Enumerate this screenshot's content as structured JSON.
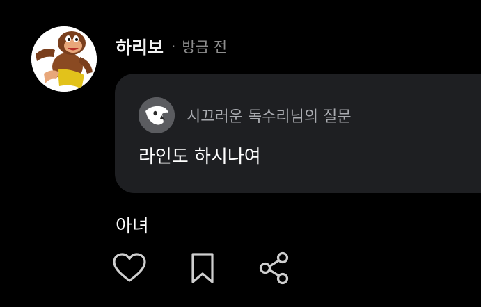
{
  "post": {
    "username": "하리보",
    "separator": "·",
    "timestamp": "방금 전"
  },
  "question": {
    "asker": "시끄러운 독수리님의 질문",
    "text": "라인도 하시나여"
  },
  "answer": {
    "text": "아녀"
  },
  "actions": [
    {
      "icon": "heart-icon"
    },
    {
      "icon": "bookmark-icon"
    },
    {
      "icon": "share-icon"
    }
  ],
  "colors": {
    "background": "#000000",
    "card": "#1e1f22",
    "muted_text": "#8e8e8e",
    "asker_text": "#a9abb0",
    "icon_stroke": "#cfcfcf"
  }
}
